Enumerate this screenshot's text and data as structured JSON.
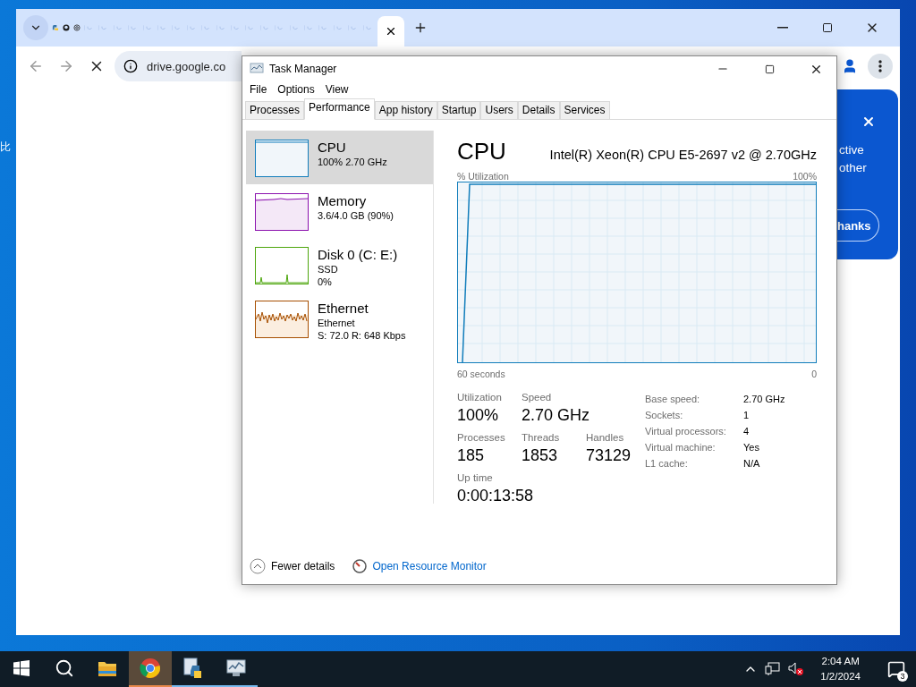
{
  "desktop": {
    "edge_text": "比"
  },
  "browser": {
    "address": "drive.google.co",
    "popup": {
      "lines": [
        "ctive",
        "other"
      ],
      "button": "hanks"
    }
  },
  "task_manager": {
    "title": "Task Manager",
    "menu": [
      "File",
      "Options",
      "View"
    ],
    "tabs": [
      {
        "label": "Processes",
        "selected": false
      },
      {
        "label": "Performance",
        "selected": true
      },
      {
        "label": "App history",
        "selected": false
      },
      {
        "label": "Startup",
        "selected": false
      },
      {
        "label": "Users",
        "selected": false
      },
      {
        "label": "Details",
        "selected": false
      },
      {
        "label": "Services",
        "selected": false
      }
    ],
    "resources": [
      {
        "kind": "cpu",
        "name": "CPU",
        "lines": [
          "100%  2.70 GHz"
        ],
        "selected": true,
        "color": "#117dbb"
      },
      {
        "kind": "memory",
        "name": "Memory",
        "lines": [
          "3.6/4.0 GB (90%)"
        ],
        "selected": false,
        "color": "#8b12ae"
      },
      {
        "kind": "disk",
        "name": "Disk 0 (C: E:)",
        "lines": [
          "SSD",
          "0%"
        ],
        "selected": false,
        "color": "#4da60c"
      },
      {
        "kind": "ethernet",
        "name": "Ethernet",
        "lines": [
          "Ethernet",
          "S: 72.0 R: 648 Kbps"
        ],
        "selected": false,
        "color": "#a74f01"
      }
    ],
    "detail": {
      "title": "CPU",
      "model": "Intel(R) Xeon(R) CPU E5-2697 v2 @ 2.70GHz",
      "graph_label": "% Utilization",
      "graph_max": "100%",
      "graph_span": "60 seconds",
      "graph_min": "0",
      "stat_rows": [
        [
          {
            "label": "Utilization",
            "value": "100%"
          },
          {
            "label": "Speed",
            "value": "2.70 GHz"
          }
        ],
        [
          {
            "label": "Processes",
            "value": "185"
          },
          {
            "label": "Threads",
            "value": "1853"
          },
          {
            "label": "Handles",
            "value": "73129"
          }
        ],
        [
          {
            "label": "Up time",
            "value": "0:00:13:58"
          }
        ]
      ],
      "specs": [
        {
          "label": "Base speed:",
          "value": "2.70 GHz"
        },
        {
          "label": "Sockets:",
          "value": "1"
        },
        {
          "label": "Virtual processors:",
          "value": "4"
        },
        {
          "label": "Virtual machine:",
          "value": "Yes"
        },
        {
          "label": "L1 cache:",
          "value": "N/A"
        }
      ]
    },
    "footer": {
      "fewer": "Fewer details",
      "monitor": "Open Resource Monitor"
    }
  },
  "taskbar": {
    "apps": [
      {
        "kind": "explorer",
        "running": false,
        "selected": false
      },
      {
        "kind": "chrome",
        "running": true,
        "selected": true
      },
      {
        "kind": "python",
        "running": true,
        "selected": false
      },
      {
        "kind": "taskmgr",
        "running": true,
        "selected": false
      }
    ],
    "time": "2:04 AM",
    "date": "1/2/2024",
    "notifications": "3"
  }
}
